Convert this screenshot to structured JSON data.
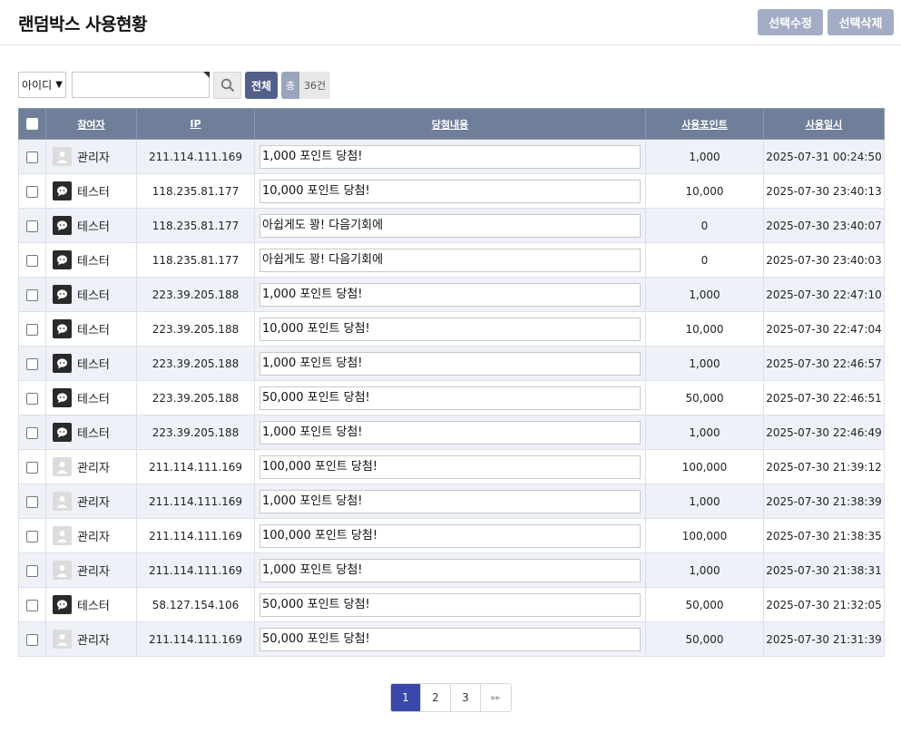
{
  "header": {
    "title": "랜덤박스 사용현황",
    "edit_label": "선택수정",
    "delete_label": "선택삭제"
  },
  "search": {
    "field_value": "아이디",
    "input_value": "",
    "all_label": "전체",
    "total_label": "총",
    "total_count": "36건"
  },
  "table": {
    "columns": [
      "참여자",
      "IP",
      "당첨내용",
      "사용포인트",
      "사용일시"
    ],
    "rows": [
      {
        "user": "관리자",
        "avatar": "admin-avatar-icon",
        "ip": "211.114.111.169",
        "content": "1,000 포인트 당첨!",
        "points": "1,000",
        "date": "2025-07-31 00:24:50"
      },
      {
        "user": "테스터",
        "avatar": "tester-avatar-icon",
        "ip": "118.235.81.177",
        "content": "10,000 포인트 당첨!",
        "points": "10,000",
        "date": "2025-07-30 23:40:13"
      },
      {
        "user": "테스터",
        "avatar": "tester-avatar-icon",
        "ip": "118.235.81.177",
        "content": "아쉽게도 꽝! 다음기회에",
        "points": "0",
        "date": "2025-07-30 23:40:07"
      },
      {
        "user": "테스터",
        "avatar": "tester-avatar-icon",
        "ip": "118.235.81.177",
        "content": "아쉽게도 꽝! 다음기회에",
        "points": "0",
        "date": "2025-07-30 23:40:03"
      },
      {
        "user": "테스터",
        "avatar": "tester-avatar-icon",
        "ip": "223.39.205.188",
        "content": "1,000 포인트 당첨!",
        "points": "1,000",
        "date": "2025-07-30 22:47:10"
      },
      {
        "user": "테스터",
        "avatar": "tester-avatar-icon",
        "ip": "223.39.205.188",
        "content": "10,000 포인트 당첨!",
        "points": "10,000",
        "date": "2025-07-30 22:47:04"
      },
      {
        "user": "테스터",
        "avatar": "tester-avatar-icon",
        "ip": "223.39.205.188",
        "content": "1,000 포인트 당첨!",
        "points": "1,000",
        "date": "2025-07-30 22:46:57"
      },
      {
        "user": "테스터",
        "avatar": "tester-avatar-icon",
        "ip": "223.39.205.188",
        "content": "50,000 포인트 당첨!",
        "points": "50,000",
        "date": "2025-07-30 22:46:51"
      },
      {
        "user": "테스터",
        "avatar": "tester-avatar-icon",
        "ip": "223.39.205.188",
        "content": "1,000 포인트 당첨!",
        "points": "1,000",
        "date": "2025-07-30 22:46:49"
      },
      {
        "user": "관리자",
        "avatar": "admin-avatar-icon",
        "ip": "211.114.111.169",
        "content": "100,000 포인트 당첨!",
        "points": "100,000",
        "date": "2025-07-30 21:39:12"
      },
      {
        "user": "관리자",
        "avatar": "admin-avatar-icon",
        "ip": "211.114.111.169",
        "content": "1,000 포인트 당첨!",
        "points": "1,000",
        "date": "2025-07-30 21:38:39"
      },
      {
        "user": "관리자",
        "avatar": "admin-avatar-icon",
        "ip": "211.114.111.169",
        "content": "100,000 포인트 당첨!",
        "points": "100,000",
        "date": "2025-07-30 21:38:35"
      },
      {
        "user": "관리자",
        "avatar": "admin-avatar-icon",
        "ip": "211.114.111.169",
        "content": "1,000 포인트 당첨!",
        "points": "1,000",
        "date": "2025-07-30 21:38:31"
      },
      {
        "user": "테스터",
        "avatar": "tester-avatar-icon",
        "ip": "58.127.154.106",
        "content": "50,000 포인트 당첨!",
        "points": "50,000",
        "date": "2025-07-30 21:32:05"
      },
      {
        "user": "관리자",
        "avatar": "admin-avatar-icon",
        "ip": "211.114.111.169",
        "content": "50,000 포인트 당첨!",
        "points": "50,000",
        "date": "2025-07-30 21:31:39"
      }
    ]
  },
  "pagination": {
    "pages": [
      "1",
      "2",
      "3"
    ],
    "current": "1",
    "next_icon": "double-chevron-right-icon"
  },
  "colors": {
    "header_bg": "#6f7f99",
    "row_alt_bg": "#eef1f8",
    "button_bg": "#a4adc6",
    "all_button_bg": "#525f8a",
    "active_page_bg": "#3949ab"
  }
}
